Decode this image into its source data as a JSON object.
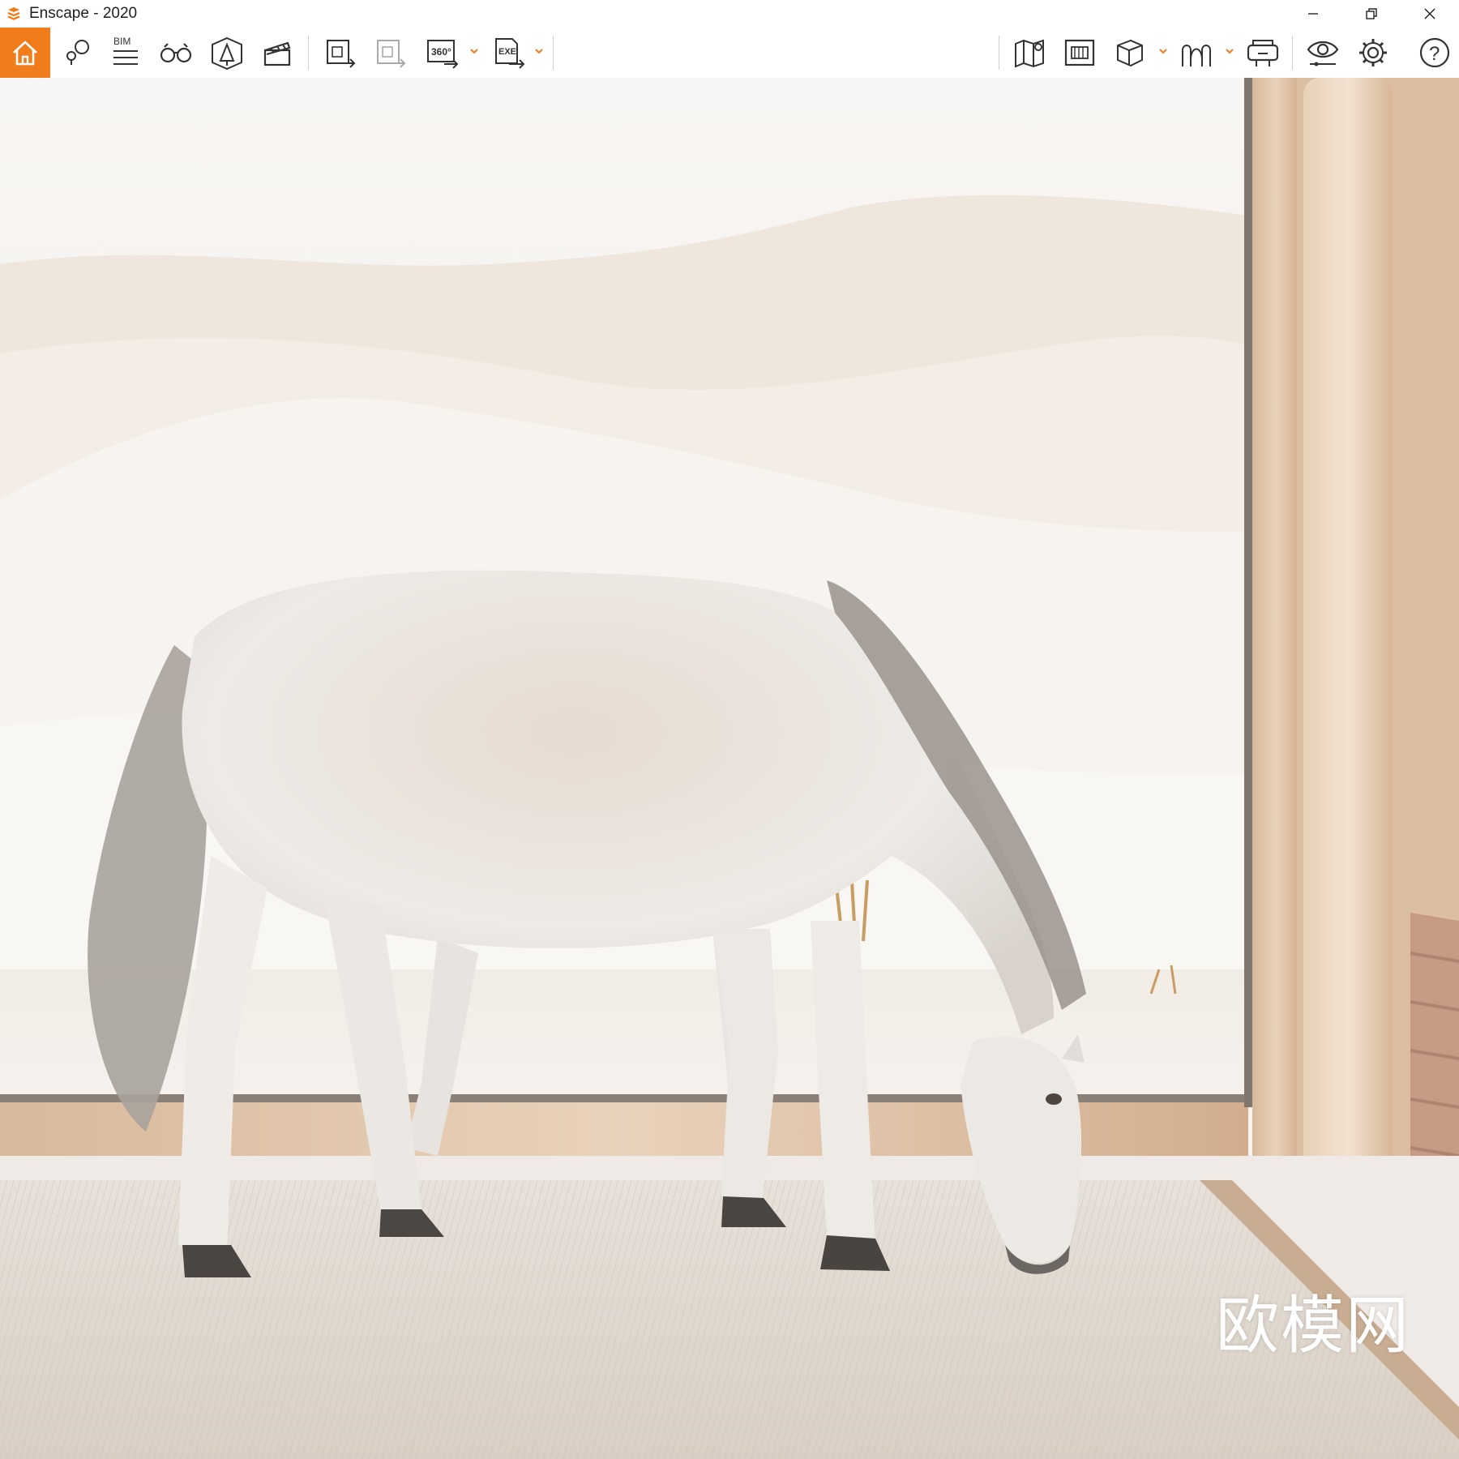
{
  "window": {
    "title": "Enscape - 2020",
    "controls": {
      "minimize": "—",
      "restore": "❐",
      "close": "✕"
    }
  },
  "toolbar": {
    "accent_color": "#f07c1b",
    "left_tools": [
      {
        "icon": "home-icon",
        "active": true
      },
      {
        "icon": "location-pins-icon"
      },
      {
        "icon": "bim-info-icon",
        "label": "BIM"
      },
      {
        "icon": "binoculars-icon"
      },
      {
        "icon": "safety-light-icon"
      },
      {
        "icon": "clapperboard-icon"
      },
      {
        "icon": "batch-render-icon"
      },
      {
        "icon": "batch-render-disabled-icon"
      },
      {
        "icon": "panorama-360-icon",
        "label": "360°"
      },
      {
        "icon": "export-exe-icon",
        "label": "EXE"
      }
    ],
    "right_tools": [
      {
        "icon": "map-icon"
      },
      {
        "icon": "asset-library-icon"
      },
      {
        "icon": "view-cube-icon"
      },
      {
        "icon": "walkthrough-icon"
      },
      {
        "icon": "vr-headset-icon"
      },
      {
        "icon": "visual-settings-eye-icon"
      },
      {
        "icon": "settings-gear-icon"
      },
      {
        "icon": "help-icon",
        "label": "?"
      }
    ]
  },
  "viewport": {
    "scene": "white horse grazing indoors in front of a large window overlooking desert dunes",
    "watermark_text": "欧模网"
  }
}
